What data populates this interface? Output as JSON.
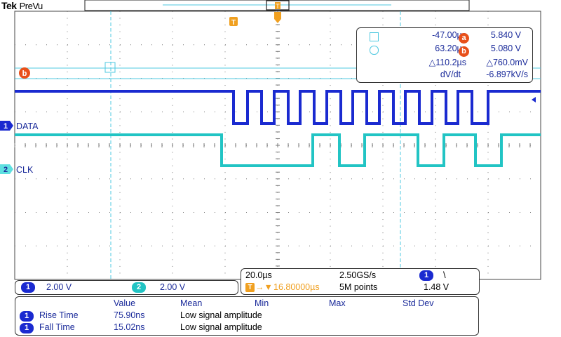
{
  "header": {
    "brand": "Tek",
    "mode": "PreVu"
  },
  "trigger_marker": "T",
  "trigger_top_label": "T",
  "cursor_readout": {
    "cursor1_time": "-47.00µs",
    "cursor1_label": "a",
    "cursor1_value": "5.840 V",
    "cursor2_time": "63.20µs",
    "cursor2_label": "b",
    "cursor2_value": "5.080 V",
    "delta_time": "△110.2µs",
    "delta_volt": "△760.0mV",
    "dvdt_label": "dV/dt",
    "dvdt_value": "-6.897kV/s"
  },
  "cursor_b_marker": "b",
  "channels": {
    "ch1": {
      "num": "1",
      "name": "DATA",
      "scale": "2.00 V",
      "color": "#1a2ad0"
    },
    "ch2": {
      "num": "2",
      "name": "CLK",
      "scale": "2.00 V",
      "color": "#22c4c4"
    }
  },
  "acquisition": {
    "timebase": "20.0µs",
    "sample_rate": "2.50GS/s",
    "trigger_source": "1",
    "trigger_slope": "\\",
    "trigger_delay": "16.80000µs",
    "record_length": "5M points",
    "trigger_level": "1.48 V"
  },
  "measurements": {
    "headers": [
      "Value",
      "Mean",
      "Min",
      "Max",
      "Std Dev"
    ],
    "rows": [
      {
        "ch": "1",
        "name": "Rise Time",
        "value": "75.90ns",
        "mean": "Low signal amplitude"
      },
      {
        "ch": "1",
        "name": "Fall Time",
        "value": "15.02ns",
        "mean": "Low signal amplitude"
      }
    ]
  },
  "colors": {
    "ch1": "#1a2ad0",
    "ch2": "#22c4c4",
    "cursor": "#4fc8e0",
    "cursor_marker": "#e8501a",
    "trigger": "#f0a020"
  }
}
